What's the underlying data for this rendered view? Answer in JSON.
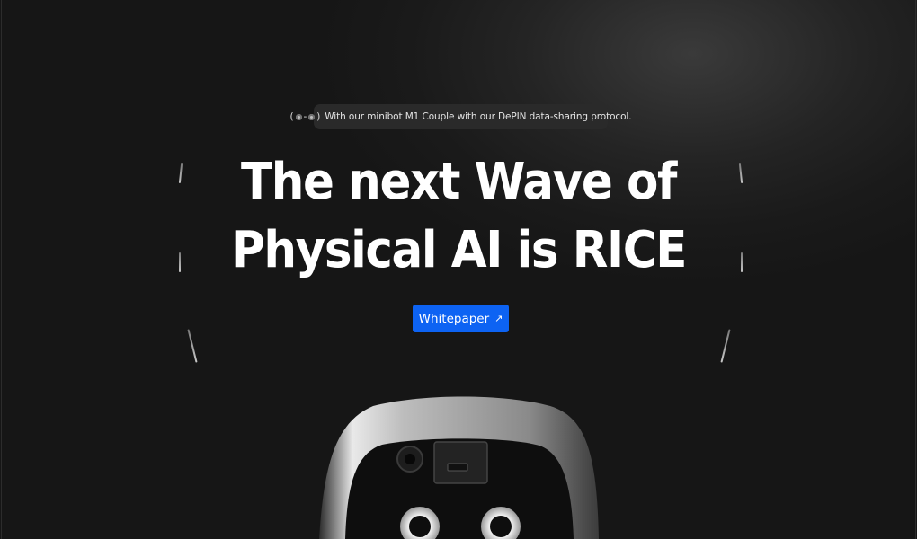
{
  "announcement": {
    "emote_open": "(",
    "emote_dash": "-",
    "emote_close": ")",
    "text": "With our minibot M1 Couple with our DePIN data-sharing protocol."
  },
  "hero": {
    "line1": "The next Wave of",
    "line2": "Physical AI is RICE"
  },
  "cta": {
    "label": "Whitepaper",
    "arrow": "↗",
    "color": "#0d63f3"
  },
  "icons": [
    "eye-icon",
    "arrow-up-right-icon"
  ],
  "robot": {
    "name": "minibot M1"
  }
}
